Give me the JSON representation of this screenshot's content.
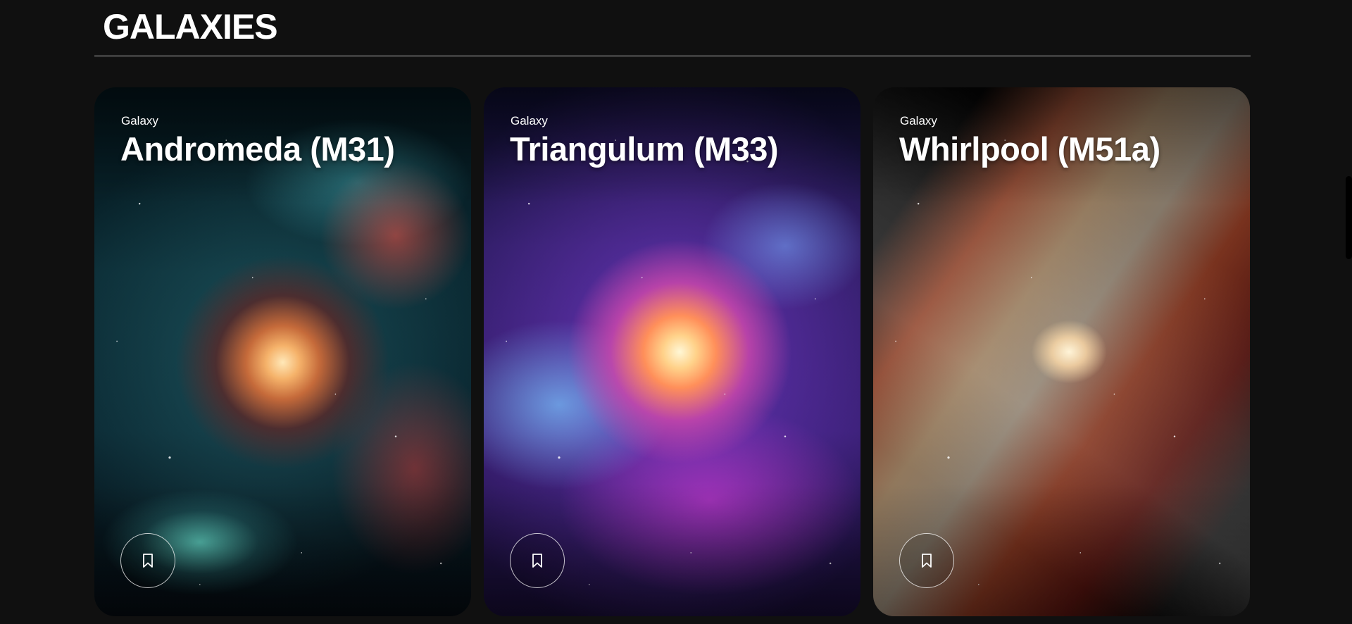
{
  "section": {
    "title": "GALAXIES"
  },
  "cards": [
    {
      "category": "Galaxy",
      "title": "Andromeda (M31)",
      "bookmark_icon": "bookmark-icon"
    },
    {
      "category": "Galaxy",
      "title": "Triangulum (M33)",
      "bookmark_icon": "bookmark-icon"
    },
    {
      "category": "Galaxy",
      "title": "Whirlpool (M51a)",
      "bookmark_icon": "bookmark-icon"
    }
  ],
  "colors": {
    "background": "#101010",
    "text": "#ffffff",
    "divider": "#bdbdbd"
  }
}
